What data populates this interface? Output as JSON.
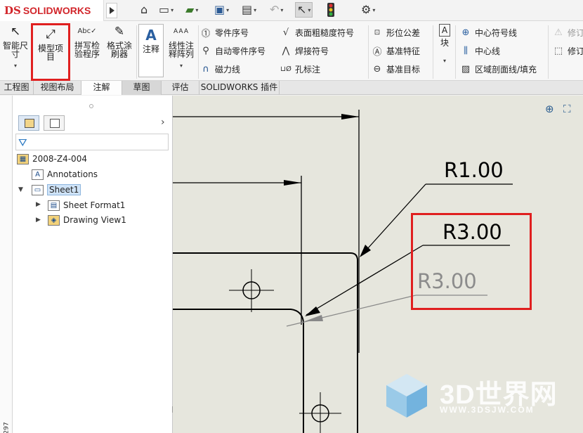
{
  "app": {
    "logo_mark": "DS",
    "logo_text": "SOLIDWORKS"
  },
  "quick_access": {
    "items": [
      {
        "name": "home-icon",
        "glyph": "⌂"
      },
      {
        "name": "new-file-icon",
        "glyph": "▭"
      },
      {
        "name": "open-folder-icon",
        "glyph": "▰"
      },
      {
        "name": "save-icon",
        "glyph": "▣"
      },
      {
        "name": "print-icon",
        "glyph": "▤"
      },
      {
        "name": "undo-icon",
        "glyph": "↶"
      },
      {
        "name": "select-pointer-icon",
        "glyph": "↖"
      },
      {
        "name": "traffic-light-icon",
        "glyph": "●"
      },
      {
        "name": "options-gear-icon",
        "glyph": "⚙"
      }
    ],
    "dropdown_glyph": "▾"
  },
  "ribbon": {
    "smart_dimension": "智能尺寸",
    "model_items": "模型项目",
    "spell_check": "拼写检验程序",
    "format_painter": "格式涂刷器",
    "note": "注释",
    "linear_note_pattern": "线性注释阵列",
    "balloon": "零件序号",
    "auto_balloon": "自动零件序号",
    "magnetic_line": "磁力线",
    "surface_finish": "表面粗糙度符号",
    "weld_symbol": "焊接符号",
    "hole_callout": "孔标注",
    "geometric_tolerance": "形位公差",
    "datum_feature": "基准特征",
    "datum_target": "基准目标",
    "block": "块",
    "center_mark": "中心符号线",
    "centerline": "中心线",
    "area_hatch": "区域剖面线/填充",
    "revision_symbol": "修订",
    "revision_cloud": "修订"
  },
  "tabs": [
    "工程图",
    "视图布局",
    "注解",
    "草图",
    "评估",
    "SOLIDWORKS 插件"
  ],
  "active_tab": "注解",
  "feature_tree": {
    "root": "2008-Z4-004",
    "items": [
      {
        "label": "Annotations"
      },
      {
        "label": "Sheet1"
      },
      {
        "label": "Sheet Format1"
      },
      {
        "label": "Drawing View1"
      }
    ]
  },
  "ruler_label": "297",
  "drawing": {
    "dim_r1": "R1.00",
    "dim_r3": "R3.00",
    "dim_r3_gray": "R3.00"
  },
  "watermark": {
    "title": "3D世界网",
    "url": "WWW.3DSJW.COM"
  },
  "colors": {
    "accent_red": "#e01f1f",
    "logo_red": "#d2262b",
    "canvas_bg": "#e6e6dd",
    "ribbon_bg": "#f7f7f7",
    "selected_blue": "#cfe3f7"
  }
}
